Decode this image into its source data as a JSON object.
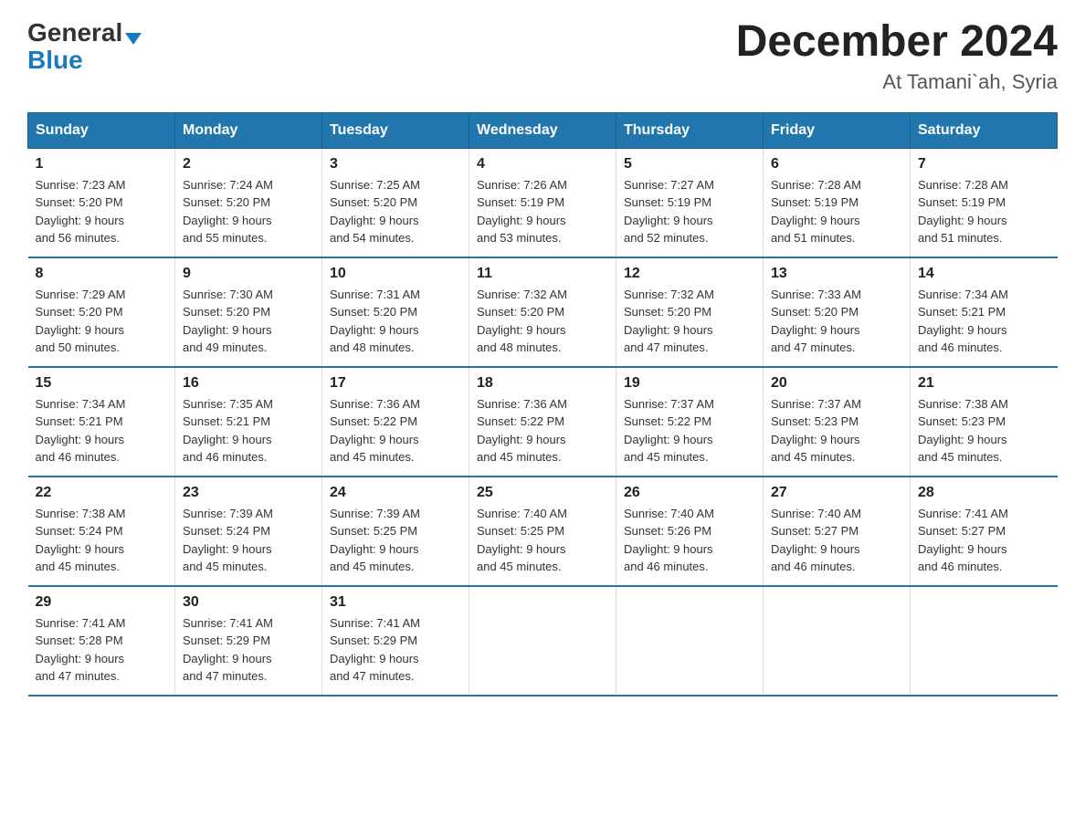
{
  "header": {
    "logo_general": "General",
    "logo_blue": "Blue",
    "title": "December 2024",
    "subtitle": "At Tamani`ah, Syria"
  },
  "days_of_week": [
    "Sunday",
    "Monday",
    "Tuesday",
    "Wednesday",
    "Thursday",
    "Friday",
    "Saturday"
  ],
  "weeks": [
    [
      {
        "day": "1",
        "sunrise": "Sunrise: 7:23 AM",
        "sunset": "Sunset: 5:20 PM",
        "daylight": "Daylight: 9 hours",
        "daylight2": "and 56 minutes."
      },
      {
        "day": "2",
        "sunrise": "Sunrise: 7:24 AM",
        "sunset": "Sunset: 5:20 PM",
        "daylight": "Daylight: 9 hours",
        "daylight2": "and 55 minutes."
      },
      {
        "day": "3",
        "sunrise": "Sunrise: 7:25 AM",
        "sunset": "Sunset: 5:20 PM",
        "daylight": "Daylight: 9 hours",
        "daylight2": "and 54 minutes."
      },
      {
        "day": "4",
        "sunrise": "Sunrise: 7:26 AM",
        "sunset": "Sunset: 5:19 PM",
        "daylight": "Daylight: 9 hours",
        "daylight2": "and 53 minutes."
      },
      {
        "day": "5",
        "sunrise": "Sunrise: 7:27 AM",
        "sunset": "Sunset: 5:19 PM",
        "daylight": "Daylight: 9 hours",
        "daylight2": "and 52 minutes."
      },
      {
        "day": "6",
        "sunrise": "Sunrise: 7:28 AM",
        "sunset": "Sunset: 5:19 PM",
        "daylight": "Daylight: 9 hours",
        "daylight2": "and 51 minutes."
      },
      {
        "day": "7",
        "sunrise": "Sunrise: 7:28 AM",
        "sunset": "Sunset: 5:19 PM",
        "daylight": "Daylight: 9 hours",
        "daylight2": "and 51 minutes."
      }
    ],
    [
      {
        "day": "8",
        "sunrise": "Sunrise: 7:29 AM",
        "sunset": "Sunset: 5:20 PM",
        "daylight": "Daylight: 9 hours",
        "daylight2": "and 50 minutes."
      },
      {
        "day": "9",
        "sunrise": "Sunrise: 7:30 AM",
        "sunset": "Sunset: 5:20 PM",
        "daylight": "Daylight: 9 hours",
        "daylight2": "and 49 minutes."
      },
      {
        "day": "10",
        "sunrise": "Sunrise: 7:31 AM",
        "sunset": "Sunset: 5:20 PM",
        "daylight": "Daylight: 9 hours",
        "daylight2": "and 48 minutes."
      },
      {
        "day": "11",
        "sunrise": "Sunrise: 7:32 AM",
        "sunset": "Sunset: 5:20 PM",
        "daylight": "Daylight: 9 hours",
        "daylight2": "and 48 minutes."
      },
      {
        "day": "12",
        "sunrise": "Sunrise: 7:32 AM",
        "sunset": "Sunset: 5:20 PM",
        "daylight": "Daylight: 9 hours",
        "daylight2": "and 47 minutes."
      },
      {
        "day": "13",
        "sunrise": "Sunrise: 7:33 AM",
        "sunset": "Sunset: 5:20 PM",
        "daylight": "Daylight: 9 hours",
        "daylight2": "and 47 minutes."
      },
      {
        "day": "14",
        "sunrise": "Sunrise: 7:34 AM",
        "sunset": "Sunset: 5:21 PM",
        "daylight": "Daylight: 9 hours",
        "daylight2": "and 46 minutes."
      }
    ],
    [
      {
        "day": "15",
        "sunrise": "Sunrise: 7:34 AM",
        "sunset": "Sunset: 5:21 PM",
        "daylight": "Daylight: 9 hours",
        "daylight2": "and 46 minutes."
      },
      {
        "day": "16",
        "sunrise": "Sunrise: 7:35 AM",
        "sunset": "Sunset: 5:21 PM",
        "daylight": "Daylight: 9 hours",
        "daylight2": "and 46 minutes."
      },
      {
        "day": "17",
        "sunrise": "Sunrise: 7:36 AM",
        "sunset": "Sunset: 5:22 PM",
        "daylight": "Daylight: 9 hours",
        "daylight2": "and 45 minutes."
      },
      {
        "day": "18",
        "sunrise": "Sunrise: 7:36 AM",
        "sunset": "Sunset: 5:22 PM",
        "daylight": "Daylight: 9 hours",
        "daylight2": "and 45 minutes."
      },
      {
        "day": "19",
        "sunrise": "Sunrise: 7:37 AM",
        "sunset": "Sunset: 5:22 PM",
        "daylight": "Daylight: 9 hours",
        "daylight2": "and 45 minutes."
      },
      {
        "day": "20",
        "sunrise": "Sunrise: 7:37 AM",
        "sunset": "Sunset: 5:23 PM",
        "daylight": "Daylight: 9 hours",
        "daylight2": "and 45 minutes."
      },
      {
        "day": "21",
        "sunrise": "Sunrise: 7:38 AM",
        "sunset": "Sunset: 5:23 PM",
        "daylight": "Daylight: 9 hours",
        "daylight2": "and 45 minutes."
      }
    ],
    [
      {
        "day": "22",
        "sunrise": "Sunrise: 7:38 AM",
        "sunset": "Sunset: 5:24 PM",
        "daylight": "Daylight: 9 hours",
        "daylight2": "and 45 minutes."
      },
      {
        "day": "23",
        "sunrise": "Sunrise: 7:39 AM",
        "sunset": "Sunset: 5:24 PM",
        "daylight": "Daylight: 9 hours",
        "daylight2": "and 45 minutes."
      },
      {
        "day": "24",
        "sunrise": "Sunrise: 7:39 AM",
        "sunset": "Sunset: 5:25 PM",
        "daylight": "Daylight: 9 hours",
        "daylight2": "and 45 minutes."
      },
      {
        "day": "25",
        "sunrise": "Sunrise: 7:40 AM",
        "sunset": "Sunset: 5:25 PM",
        "daylight": "Daylight: 9 hours",
        "daylight2": "and 45 minutes."
      },
      {
        "day": "26",
        "sunrise": "Sunrise: 7:40 AM",
        "sunset": "Sunset: 5:26 PM",
        "daylight": "Daylight: 9 hours",
        "daylight2": "and 46 minutes."
      },
      {
        "day": "27",
        "sunrise": "Sunrise: 7:40 AM",
        "sunset": "Sunset: 5:27 PM",
        "daylight": "Daylight: 9 hours",
        "daylight2": "and 46 minutes."
      },
      {
        "day": "28",
        "sunrise": "Sunrise: 7:41 AM",
        "sunset": "Sunset: 5:27 PM",
        "daylight": "Daylight: 9 hours",
        "daylight2": "and 46 minutes."
      }
    ],
    [
      {
        "day": "29",
        "sunrise": "Sunrise: 7:41 AM",
        "sunset": "Sunset: 5:28 PM",
        "daylight": "Daylight: 9 hours",
        "daylight2": "and 47 minutes."
      },
      {
        "day": "30",
        "sunrise": "Sunrise: 7:41 AM",
        "sunset": "Sunset: 5:29 PM",
        "daylight": "Daylight: 9 hours",
        "daylight2": "and 47 minutes."
      },
      {
        "day": "31",
        "sunrise": "Sunrise: 7:41 AM",
        "sunset": "Sunset: 5:29 PM",
        "daylight": "Daylight: 9 hours",
        "daylight2": "and 47 minutes."
      },
      {
        "day": "",
        "sunrise": "",
        "sunset": "",
        "daylight": "",
        "daylight2": ""
      },
      {
        "day": "",
        "sunrise": "",
        "sunset": "",
        "daylight": "",
        "daylight2": ""
      },
      {
        "day": "",
        "sunrise": "",
        "sunset": "",
        "daylight": "",
        "daylight2": ""
      },
      {
        "day": "",
        "sunrise": "",
        "sunset": "",
        "daylight": "",
        "daylight2": ""
      }
    ]
  ]
}
